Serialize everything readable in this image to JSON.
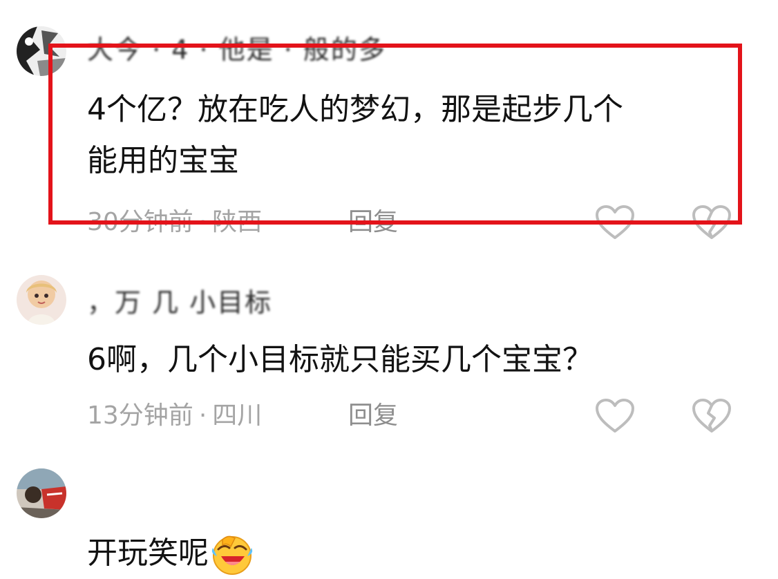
{
  "comments": [
    {
      "username": "大今 · 4 · 他是 · 般的多",
      "text_lines": [
        "4个亿？放在吃人的梦幻，那是起步几个",
        "能用的宝宝"
      ],
      "time": "30分钟前",
      "dot": "·",
      "location": "陕西",
      "reply_label": "回复"
    },
    {
      "username": "，万 几 小目标",
      "text_lines": [
        "6啊，几个小目标就只能买几个宝宝？"
      ],
      "time": "13分钟前",
      "dot": "·",
      "location": "四川",
      "reply_label": "回复"
    },
    {
      "username": "",
      "text_lines": [
        "开玩笑呢"
      ],
      "emoji": "face-covering-mouth-laughing"
    }
  ],
  "colors": {
    "highlight": "#e3131a",
    "meta_text": "#a4a4a4",
    "body_text": "#121212",
    "icon_stroke": "#bdbdbd"
  }
}
